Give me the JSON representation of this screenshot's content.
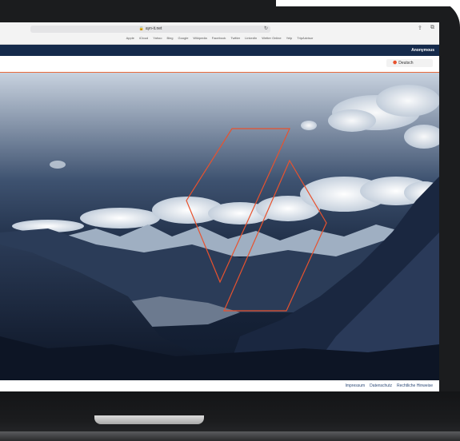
{
  "browser": {
    "url": "ayn-it.net",
    "bookmarks": [
      "Apple",
      "iCloud",
      "Yahoo",
      "Bing",
      "Google",
      "Wikipedia",
      "Facebook",
      "Twitter",
      "LinkedIn",
      "Wetter Online",
      "Yelp",
      "TripAdvisor"
    ]
  },
  "header": {
    "user": "Anonymous",
    "language": "Deutsch"
  },
  "footer": {
    "links": [
      "Impressum",
      "Datenschutz",
      "Rechtliche Hinweise"
    ]
  },
  "colors": {
    "accent": "#e8522e",
    "nav": "#152a4b",
    "link": "#2d4a78"
  }
}
